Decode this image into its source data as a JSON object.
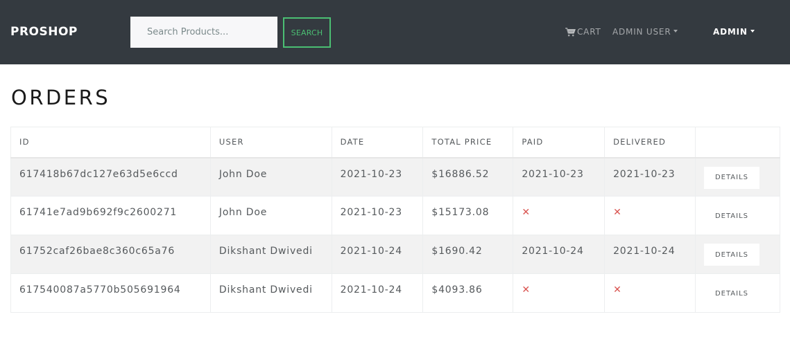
{
  "navbar": {
    "brand": "PROSHOP",
    "search": {
      "placeholder": "Search Products...",
      "value": "",
      "button_label": "SEARCH"
    },
    "cart_label": "CART",
    "user_menu_label": "ADMIN USER",
    "admin_menu_label": "ADMIN",
    "colors": {
      "background": "#343a40",
      "accent": "#4bbf73"
    }
  },
  "page": {
    "title": "ORDERS"
  },
  "orders_table": {
    "headers": [
      "ID",
      "USER",
      "DATE",
      "TOTAL PRICE",
      "PAID",
      "DELIVERED",
      ""
    ],
    "rows": [
      {
        "id": "617418b67dc127e63d5e6ccd",
        "user": "John Doe",
        "date": "2021-10-23",
        "total": "$16886.52",
        "paid": "2021-10-23",
        "delivered": "2021-10-23",
        "action": "DETAILS"
      },
      {
        "id": "61741e7ad9b692f9c2600271",
        "user": "John Doe",
        "date": "2021-10-23",
        "total": "$15173.08",
        "paid": "✕",
        "delivered": "✕",
        "action": "DETAILS"
      },
      {
        "id": "61752caf26bae8c360c65a76",
        "user": "Dikshant Dwivedi",
        "date": "2021-10-24",
        "total": "$1690.42",
        "paid": "2021-10-24",
        "delivered": "2021-10-24",
        "action": "DETAILS"
      },
      {
        "id": "617540087a5770b505691964",
        "user": "Dikshant Dwivedi",
        "date": "2021-10-24",
        "total": "$4093.86",
        "paid": "✕",
        "delivered": "✕",
        "action": "DETAILS"
      }
    ],
    "colors": {
      "not_paid": "#d9534f",
      "stripe": "#f2f2f2"
    }
  }
}
